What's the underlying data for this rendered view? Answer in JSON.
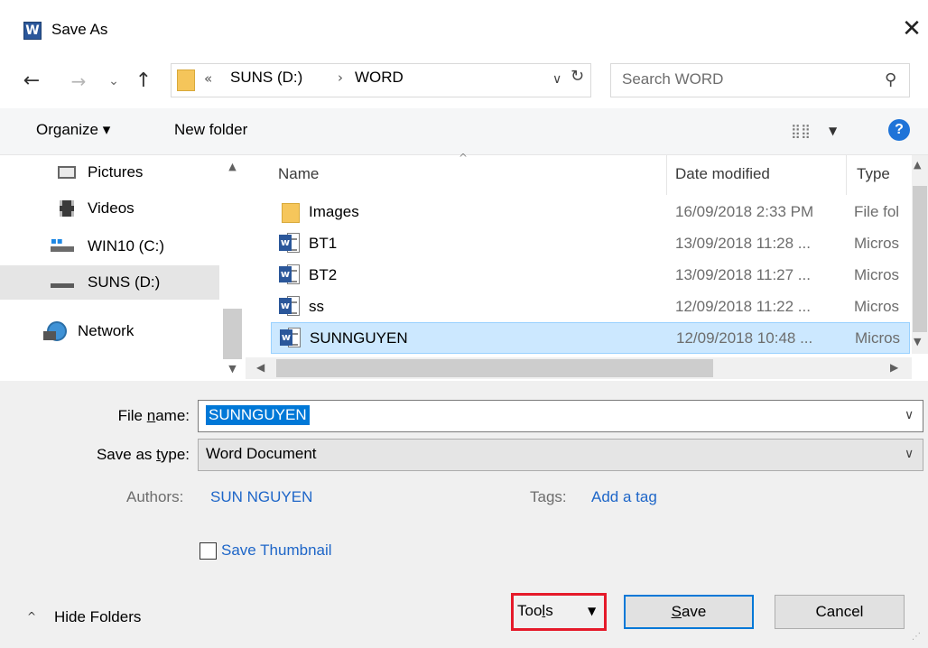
{
  "window": {
    "app_icon_letter": "W",
    "title": "Save As",
    "close_glyph": "✕"
  },
  "address": {
    "overflow_chevrons": "«",
    "crumbs": [
      "SUNS (D:)",
      "WORD"
    ],
    "separator": "›",
    "search_placeholder": "Search WORD"
  },
  "toolbar": {
    "organize_label": "Organize ▾",
    "new_folder_label": "New folder",
    "view_icon": "view-options-icon",
    "help_label": "?"
  },
  "nav": {
    "items": [
      {
        "label": "Pictures",
        "icon": "pictures-icon"
      },
      {
        "label": "Videos",
        "icon": "videos-icon"
      },
      {
        "label": "WIN10 (C:)",
        "icon": "drive-c-icon"
      },
      {
        "label": "SUNS (D:)",
        "icon": "drive-d-icon",
        "selected": true
      },
      {
        "label": "Network",
        "icon": "network-icon"
      }
    ]
  },
  "files": {
    "columns": [
      "Name",
      "Date modified",
      "Type"
    ],
    "rows": [
      {
        "name": "Images",
        "date": "16/09/2018 2:33 PM",
        "type": "File fol",
        "icon": "folder-icon"
      },
      {
        "name": "BT1",
        "date": "13/09/2018 11:28 ...",
        "type": "Micros",
        "icon": "word-doc-icon"
      },
      {
        "name": "BT2",
        "date": "13/09/2018 11:27 ...",
        "type": "Micros",
        "icon": "word-doc-icon"
      },
      {
        "name": "ss",
        "date": "12/09/2018 11:22 ...",
        "type": "Micros",
        "icon": "word-doc-icon"
      },
      {
        "name": "SUNNGUYEN",
        "date": "12/09/2018 10:48 ...",
        "type": "Micros",
        "icon": "word-doc-icon",
        "selected": true
      }
    ]
  },
  "form": {
    "file_name_label_pre": "File ",
    "file_name_label_u": "n",
    "file_name_label_post": "ame:",
    "file_name_value": "SUNNGUYEN",
    "save_type_label_pre": "Save as ",
    "save_type_label_u": "t",
    "save_type_label_post": "ype:",
    "save_type_value": "Word Document",
    "authors_label": "Authors:",
    "authors_value": "SUN NGUYEN",
    "tags_label": "Tags:",
    "tags_value": "Add a tag",
    "thumbnail_label": "Save Thumbnail"
  },
  "footer": {
    "hide_folders_label": "Hide Folders",
    "tools_label_pre": "Too",
    "tools_label_u": "l",
    "tools_label_post": "s",
    "save_label_u": "S",
    "save_label_post": "ave",
    "cancel_label": "Cancel"
  },
  "colors": {
    "accent": "#0078d7",
    "selection": "#cce8ff",
    "link": "#1e66c8",
    "highlight_box": "#e51a2a"
  }
}
